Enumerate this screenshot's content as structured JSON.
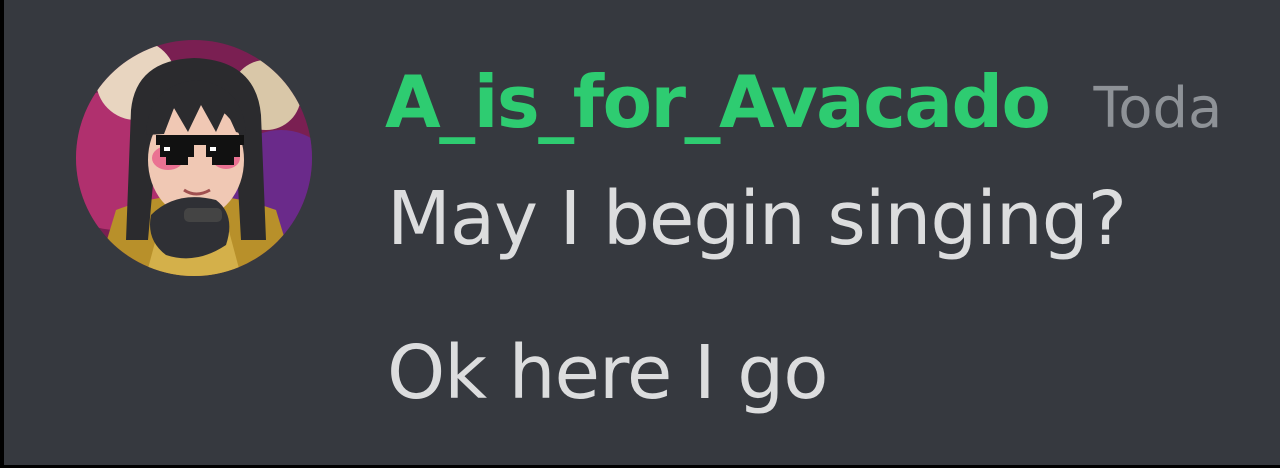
{
  "message_group": {
    "author": {
      "username": "A_is_for_Avacado",
      "username_color": "#2ecc71",
      "avatar_icon": "user-avatar-image"
    },
    "timestamp": "Toda",
    "messages": [
      {
        "text": "May I begin singing?"
      },
      {
        "text": "Ok here I go"
      }
    ]
  },
  "colors": {
    "background": "#36393f",
    "message_text": "#dcddde",
    "timestamp_text": "#8e9297"
  }
}
